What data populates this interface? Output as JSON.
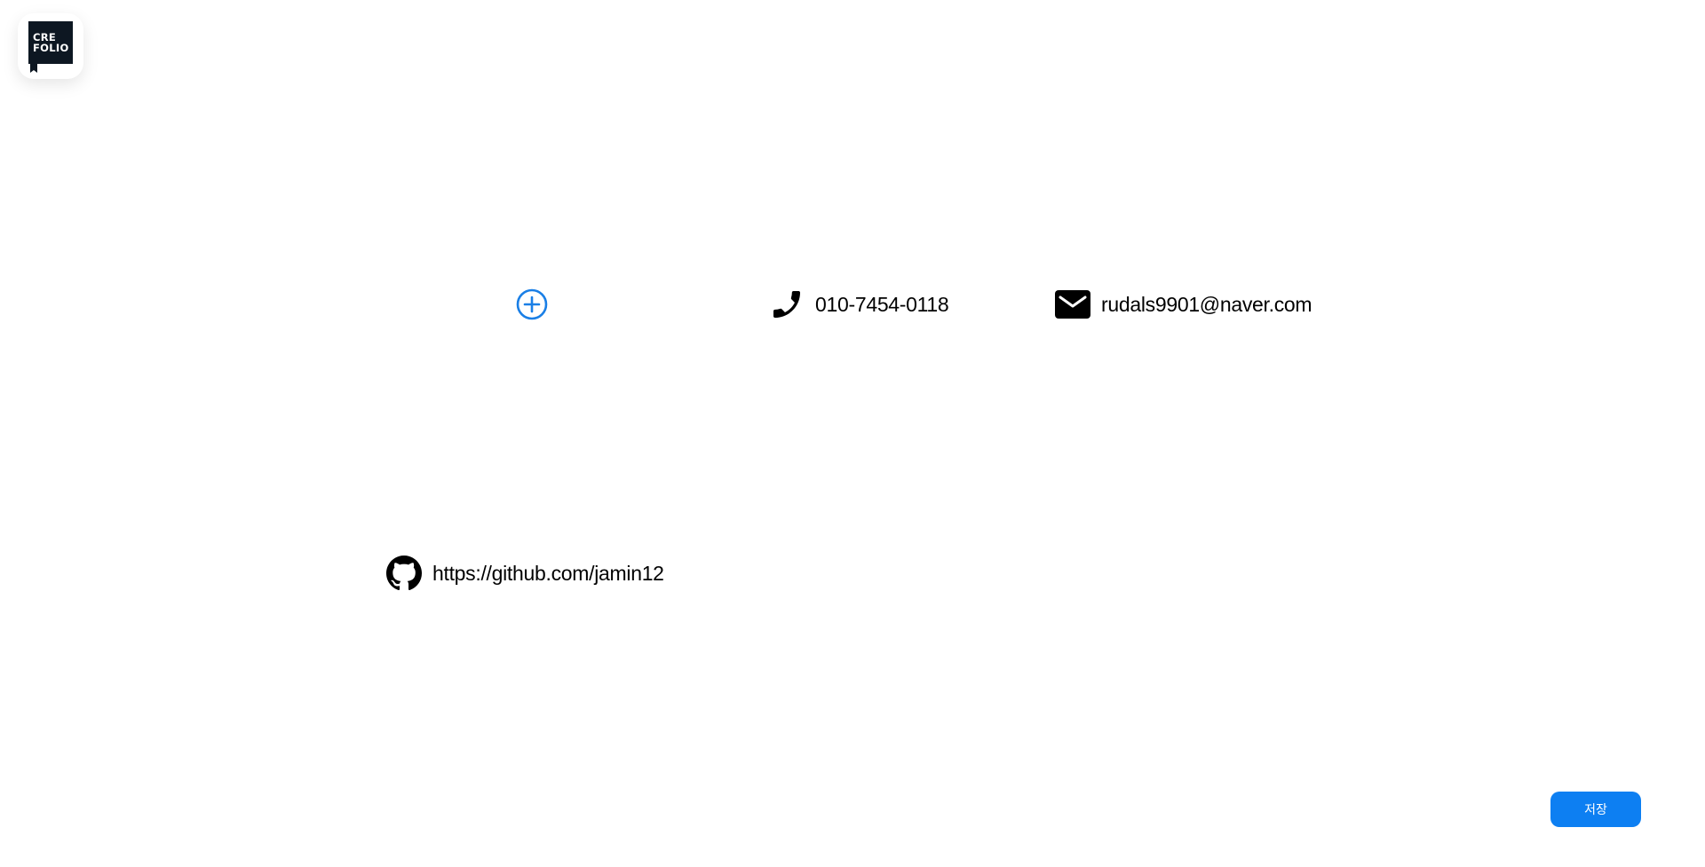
{
  "header": {
    "logo": {
      "line1": "CRE",
      "line2": "FOLIO",
      "icon": "crefolio-logo-icon"
    }
  },
  "profile": {
    "add_button_icon": "plus-circle-icon",
    "accent_color": "#1a7fe6"
  },
  "contacts": {
    "phone": {
      "icon": "phone-icon",
      "value": "010-7454-0118"
    },
    "email": {
      "icon": "mail-icon",
      "value": "rudals9901@naver.com"
    },
    "github": {
      "icon": "github-icon",
      "value": "https://github.com/jamin12"
    }
  },
  "actions": {
    "save_label": "저장",
    "save_color": "#0d7ff2"
  }
}
